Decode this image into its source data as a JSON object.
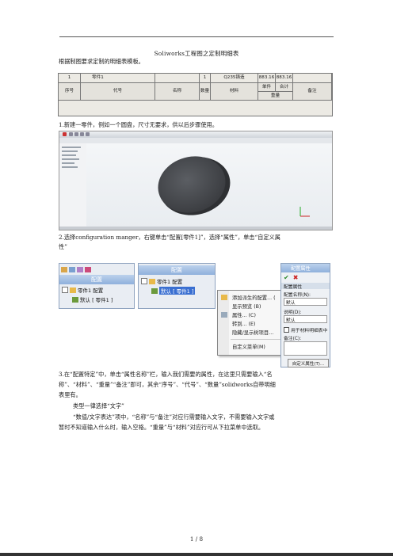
{
  "doc": {
    "title": "Soliworks工程图之定制明细表",
    "intro": "根据制图要求定制的明细表模板。",
    "step1": "1.新建一零件，例如一个圆盘，尺寸无要求，供以后步骤使用。",
    "step2_line1": "2.选择configuration manger，右键单击“配置[零件1]”，选择“属性”，单击“自定义属",
    "step2_line2": "性”",
    "step3_line1": "3.在“配置特定”中，单击“属性名称”栏，输入我们需要的属性，在这里只需要输入“名",
    "step3_line2": "称”、“材料”、“重量”“备注”即可，其余“序号”、“代号”、“数量”solidworks自带明细",
    "step3_line3": "表里有。",
    "note1": "类型一律选择“文字”",
    "note2_line1": "“数值/文字表达”项中，“名称”与“备注”对应行需要输入文字，不需要输入文字或",
    "note2_line2": "暂时不知道输入什么时，输入空格。“重量”与“材料”对应行可从下拉菜单中选取。",
    "page_number": "1 / 8"
  },
  "bom": {
    "row1": [
      "1",
      "零件1",
      "1",
      "Q235铸造",
      "883.16",
      "883.16"
    ],
    "headers": [
      "序号",
      "代号",
      "名称",
      "数量",
      "材料",
      "单件",
      "合计",
      "重量",
      "备注"
    ]
  },
  "config_tree": {
    "title": "配置",
    "root": "零件1 配置",
    "child": "默认 [ 零件1 ]",
    "tabs_icons": [
      "feature-tree-icon",
      "property-icon",
      "config-icon",
      "dim-icon"
    ]
  },
  "config_tree2": {
    "title": "配置",
    "root": "零件1 配置",
    "child_selected": "默认 [ 零件1 ]"
  },
  "context_menu": {
    "items": [
      "添加派生的配置... (",
      "显示预览 (B)",
      "属性... (C)",
      "转到... (E)",
      "隐藏/显示树项目...",
      "自定义菜单(M)"
    ]
  },
  "properties_panel": {
    "title": "配置属性",
    "section": "配置属性",
    "name_label": "配置名称(N):",
    "name_value": "默认",
    "desc_label": "说明(D):",
    "desc_value": "默认",
    "checkbox_label": "用于材料明细表中",
    "comment_label": "备注(C):",
    "custom_button": "自定义属性(T)..."
  }
}
